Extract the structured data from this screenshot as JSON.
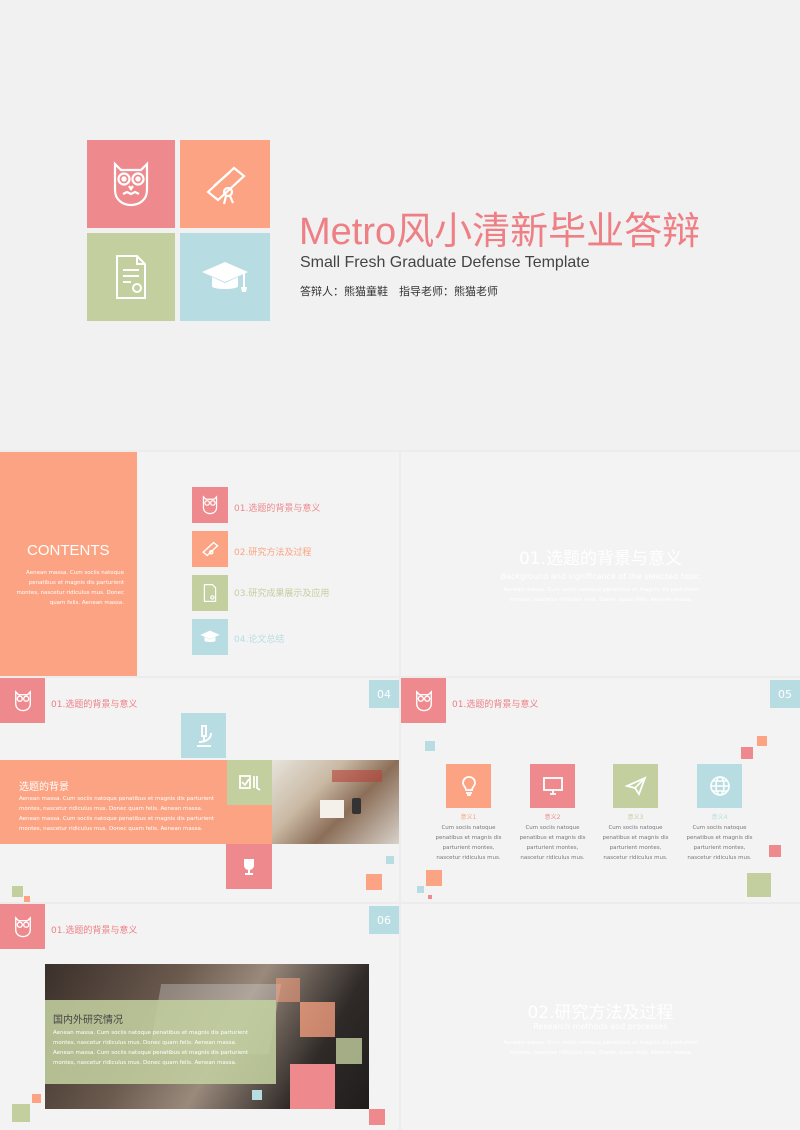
{
  "cover": {
    "title": "Metro风小清新毕业答辩",
    "subtitle": "Small Fresh Graduate Defense Template",
    "presenter_label": "答辩人：熊猫童鞋",
    "advisor_label": "指导老师：熊猫老师"
  },
  "contents": {
    "heading": "CONTENTS",
    "desc": "Aenean massa. Cum sociis natoque penatibus et magnis dis parturient montes, nascetur ridiculus mus. Donec quam felis. Aenean massa.",
    "items": [
      {
        "label": "01.选题的背景与意义",
        "color": "#ee8a8e"
      },
      {
        "label": "02.研究方法及过程",
        "color": "#fba382"
      },
      {
        "label": "03.研究成果展示及应用",
        "color": "#c3cf9f"
      },
      {
        "label": "04.论文总结",
        "color": "#b7dde3"
      }
    ]
  },
  "section1": {
    "title": "01.选题的背景与意义",
    "subtitle": "Background and significance of the selected topic",
    "desc": "Aenean massa. Cum sociis natoque penatibus et magnis dis parturient montes, nascetur ridiculus mus. Donec quam felis. Aenean massa."
  },
  "slide04": {
    "number": "04",
    "header": "01.选题的背景与意义",
    "block_title": "选题的背景",
    "block_text": "Aenean massa. Cum sociis natoque penatibus et magnis dis parturient montes, nascetur ridiculus mus. Donec quam felis. Aenean massa. Aenean massa. Cum sociis natoque penatibus et magnis dis parturient montes, nascetur ridiculus mus. Donec quam felis. Aenean massa."
  },
  "slide05": {
    "number": "05",
    "header": "01.选题的背景与意义",
    "items": [
      {
        "label": "意义1",
        "text": "Cum sociis natoque penatibus et magnis dis parturient montes, nascetur ridiculus mus."
      },
      {
        "label": "意义2",
        "text": "Cum sociis natoque penatibus et magnis dis parturient montes, nascetur ridiculus mus."
      },
      {
        "label": "意义3",
        "text": "Cum sociis natoque penatibus et magnis dis parturient montes, nascetur ridiculus mus."
      },
      {
        "label": "意义4",
        "text": "Cum sociis natoque penatibus et magnis dis parturient montes, nascetur ridiculus mus."
      }
    ]
  },
  "slide06": {
    "number": "06",
    "header": "01.选题的背景与意义",
    "block_title": "国内外研究情况",
    "block_text": "Aenean massa. Cum sociis natoque penatibus et magnis dis parturient montes, nascetur ridiculus mus. Donec quam felis. Aenean massa. Aenean massa. Cum sociis natoque penatibus et magnis dis parturient montes, nascetur ridiculus mus. Donec quam felis. Aenean massa."
  },
  "section2": {
    "title": "02.研究方法及过程",
    "subtitle": "Research methods and processes",
    "desc": "Aenean massa. Cum sociis natoque penatibus et magnis dis parturient montes, nascetur ridiculus mus. Donec quam felis. Aenean massa."
  },
  "colors": {
    "pink": "#ee8a8e",
    "orange": "#fba382",
    "green": "#c3cf9f",
    "blue": "#b7dde3"
  },
  "icons": [
    "owl-icon",
    "diploma-icon",
    "certificate-icon",
    "graduation-cap-icon",
    "microscope-icon",
    "checklist-icon",
    "trophy-icon",
    "lightbulb-icon",
    "monitor-icon",
    "paper-plane-icon",
    "globe-icon"
  ]
}
